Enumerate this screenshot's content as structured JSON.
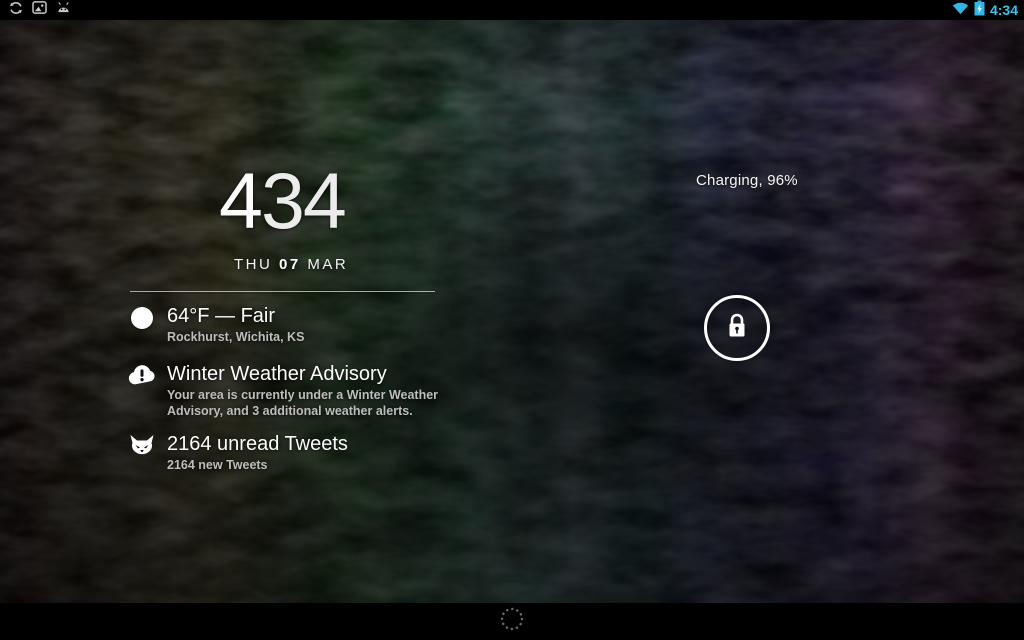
{
  "status_bar": {
    "time": "4:34",
    "accent_color": "#33b5e5",
    "left_icons": [
      "sync-icon",
      "gallery-icon",
      "android-usb-icon"
    ],
    "right_icons": [
      "wifi-icon",
      "battery-charging-icon"
    ]
  },
  "lock_screen": {
    "charging_status": "Charging, 96%",
    "clock": {
      "hours": "4",
      "minutes": "34"
    },
    "date": {
      "weekday": "THU",
      "day": "07",
      "month": "MAR"
    },
    "extensions": {
      "weather": {
        "icon": "weather-clear-circle-icon",
        "title": "64°F — Fair",
        "body": "Rockhurst, Wichita, KS"
      },
      "advisory": {
        "icon": "cloud-alert-icon",
        "title": "Winter Weather Advisory",
        "body": "Your area is currently under a Winter Weather Advisory, and 3 additional weather alerts."
      },
      "tweets": {
        "icon": "falcon-bird-icon",
        "title": "2164 unread Tweets",
        "body": "2164 new Tweets"
      }
    },
    "lock_icon": "padlock-icon",
    "nav_hint": "dotted-circle-icon"
  }
}
